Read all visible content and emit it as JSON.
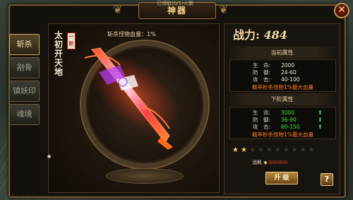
{
  "window": {
    "title": "神器",
    "top_caption": "已领取(0/1)人剩"
  },
  "side_tabs": [
    {
      "label": "斩杀",
      "active": true
    },
    {
      "label": "剐骨",
      "active": false
    },
    {
      "label": "镇妖印",
      "active": false
    },
    {
      "label": "魂境",
      "active": false
    }
  ],
  "artifact": {
    "name": "太初开天地",
    "rank": "一阶",
    "kill_rate_label": "斩杀怪物血量：1%",
    "weapon_icon": "flaming-sword-icon"
  },
  "power": {
    "label": "战力:",
    "value": "484"
  },
  "current": {
    "heading": "当前属性",
    "rows": [
      {
        "label": "生　命:",
        "value": "2000"
      },
      {
        "label": "防　御:",
        "value": "24-60"
      },
      {
        "label": "攻　击:",
        "value": "40-100"
      }
    ],
    "special": "概率秒杀怪物1%最大血量"
  },
  "next": {
    "heading": "下阶属性",
    "rows": [
      {
        "label": "生　命:",
        "value": "3000"
      },
      {
        "label": "防　御:",
        "value": "36-90"
      },
      {
        "label": "攻　击:",
        "value": "60-150"
      }
    ],
    "special": "概率秒杀怪物1%最大血量"
  },
  "stars": {
    "filled": 2,
    "total": 10
  },
  "cost": {
    "label": "消耗",
    "value": "600000",
    "currency_icon": "gold-ingot-icon"
  },
  "buttons": {
    "upgrade": "升 级",
    "help": "?",
    "close": "✕"
  },
  "colors": {
    "frame": "#6b5330",
    "gold_text": "#f4d88a",
    "green_stat": "#3fe03a",
    "orange_special": "#ff7a1c",
    "cost_red": "#e33c26"
  }
}
